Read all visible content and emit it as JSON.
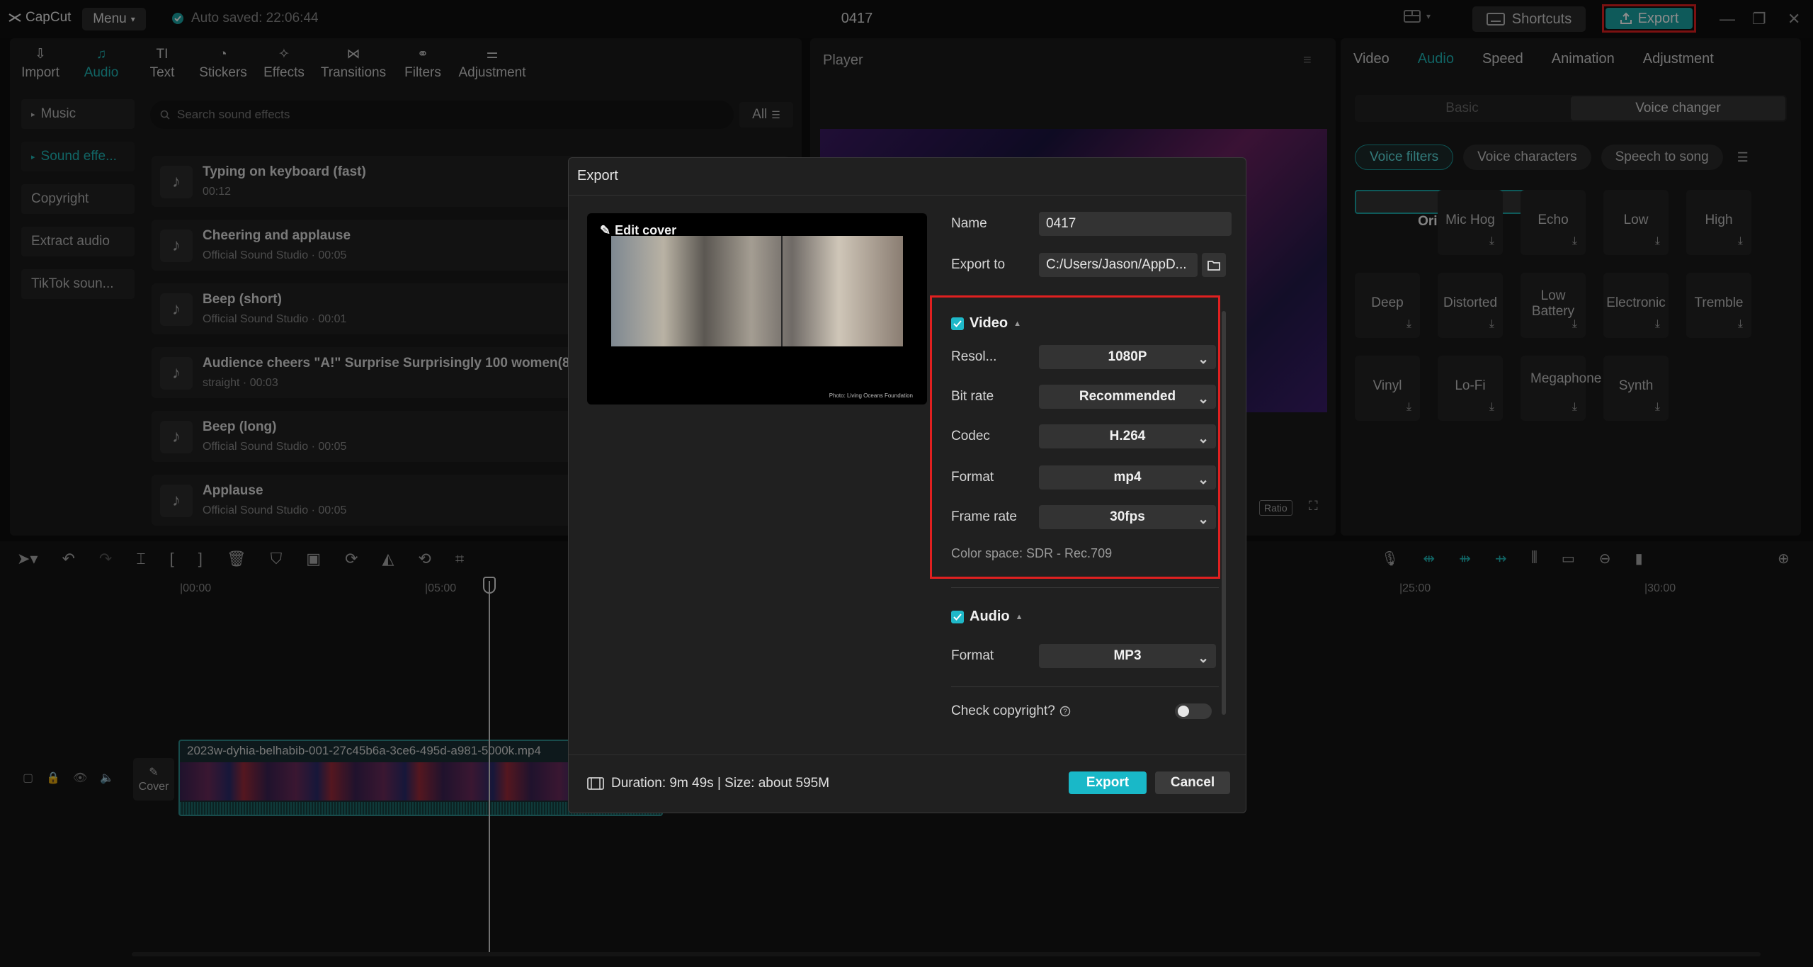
{
  "app": {
    "name": "CapCut",
    "menu_label": "Menu",
    "autosave": "Auto saved: 22:06:44",
    "project_title": "0417",
    "shortcuts_label": "Shortcuts",
    "export_label": "Export"
  },
  "media_tabs": [
    {
      "label": "Import",
      "icon": "import-icon"
    },
    {
      "label": "Audio",
      "icon": "audio-icon"
    },
    {
      "label": "Text",
      "icon": "text-icon"
    },
    {
      "label": "Stickers",
      "icon": "stickers-icon"
    },
    {
      "label": "Effects",
      "icon": "effects-icon"
    },
    {
      "label": "Transitions",
      "icon": "transitions-icon"
    },
    {
      "label": "Filters",
      "icon": "filters-icon"
    },
    {
      "label": "Adjustment",
      "icon": "adjustment-icon"
    }
  ],
  "audio_categories": [
    "Music",
    "Sound effe...",
    "Copyright",
    "Extract audio",
    "TikTok soun..."
  ],
  "search": {
    "placeholder": "Search sound effects",
    "filter_label": "All"
  },
  "sounds": [
    {
      "title": "Typing on keyboard (fast)",
      "meta": "00:12"
    },
    {
      "title": "Cheering and applause",
      "meta": "Official Sound Studio · 00:05"
    },
    {
      "title": "Beep (short)",
      "meta": "Official Sound Studio · 00:01"
    },
    {
      "title": "Audience cheers \"A!\" Surprise Surprisingly 100 women(8",
      "meta": "straight · 00:03"
    },
    {
      "title": "Beep (long)",
      "meta": "Official Sound Studio · 00:05"
    },
    {
      "title": "Applause",
      "meta": "Official Sound Studio · 00:05"
    }
  ],
  "player": {
    "title": "Player",
    "ratio_label": "Ratio"
  },
  "inspector": {
    "tabs": [
      "Video",
      "Audio",
      "Speed",
      "Animation",
      "Adjustment"
    ],
    "segments": [
      "Basic",
      "Voice changer"
    ],
    "chips": [
      "Voice filters",
      "Voice characters",
      "Speech to song"
    ],
    "voices": [
      "Original",
      "Mic Hog",
      "Echo",
      "Low",
      "High",
      "Deep",
      "Distorted",
      "Low Battery",
      "Electronic",
      "Tremble",
      "Vinyl",
      "Lo-Fi",
      "Megaphone",
      "Synth"
    ]
  },
  "timeline": {
    "ruler": [
      "|00:00",
      "|05:00",
      "|25:00",
      "|30:00"
    ],
    "cover_label": "Cover",
    "clip_name": "2023w-dyhia-belhabib-001-27c45b6a-3ce6-495d-a981-5000k.mp4"
  },
  "dialog": {
    "title": "Export",
    "edit_cover": "Edit cover",
    "watermark": "Photo: Living Oceans Foundation",
    "name_label": "Name",
    "name_value": "0417",
    "export_to_label": "Export to",
    "export_to_value": "C:/Users/Jason/AppD...",
    "video_header": "Video",
    "video_rows": [
      {
        "label": "Resol...",
        "value": "1080P"
      },
      {
        "label": "Bit rate",
        "value": "Recommended"
      },
      {
        "label": "Codec",
        "value": "H.264"
      },
      {
        "label": "Format",
        "value": "mp4"
      },
      {
        "label": "Frame rate",
        "value": "30fps"
      }
    ],
    "color_space": "Color space: SDR - Rec.709",
    "audio_header": "Audio",
    "audio_format_label": "Format",
    "audio_format_value": "MP3",
    "copyright_label": "Check copyright?",
    "copyright_enabled": false,
    "duration": "Duration: 9m 49s | Size: about 595M",
    "export_button": "Export",
    "cancel_button": "Cancel"
  },
  "colors": {
    "accent": "#1fb5b5",
    "highlight_border": "#e02020",
    "export_button": "#19b8c8"
  }
}
